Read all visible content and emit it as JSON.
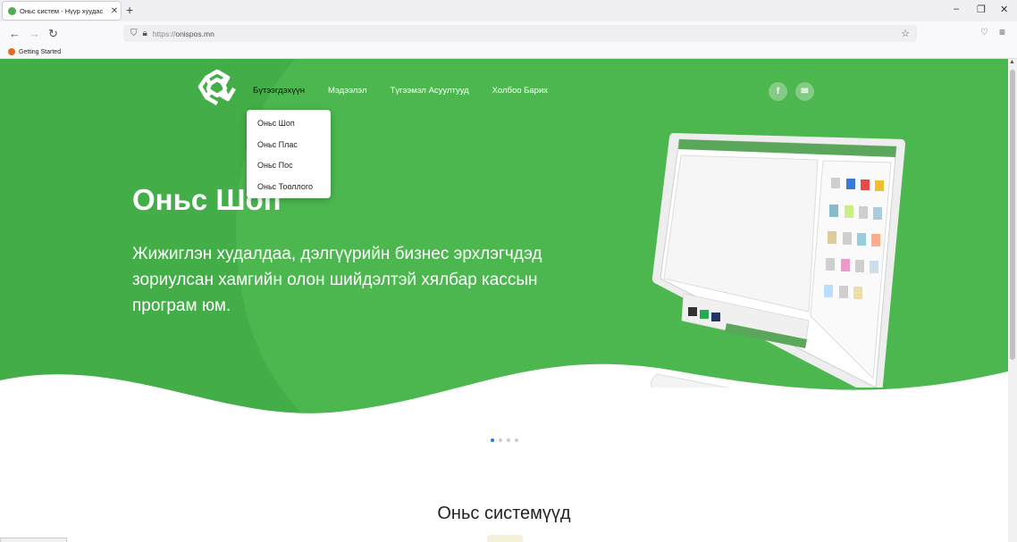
{
  "browser": {
    "tab_title": "Оньс систем - Нүүр хуудас",
    "tab_close": "✕",
    "new_tab": "+",
    "url_scheme": "https://",
    "url_host": "onispos.mn",
    "bookmark": "Getting Started",
    "back": "←",
    "forward": "→",
    "reload": "↻",
    "minimize": "–",
    "restore": "❐",
    "close": "✕",
    "menu": "≡"
  },
  "site": {
    "nav": [
      "Бүтээгдэхүүн",
      "Мэдээлэл",
      "Түгээмэл Асуултууд",
      "Холбоо Барих"
    ],
    "dropdown": [
      "Оньс Шоп",
      "Оньс Плас",
      "Оньс Пос",
      "Оньс Тооллого"
    ],
    "social": [
      "f",
      "✉"
    ],
    "hero_title": "Оньс Шоп",
    "hero_text": "Жижиглэн худалдаа, дэлгүүрийн бизнес эрхлэгчдэд зориулсан хамгийн олон шийдэлтэй хялбар кассын програм юм.",
    "section_title": "Оньс системүүд"
  },
  "slider": {
    "count": 4,
    "active": 0
  },
  "colors": {
    "brand_green": "#4cb74f",
    "dot_active": "#2a7ae2"
  }
}
